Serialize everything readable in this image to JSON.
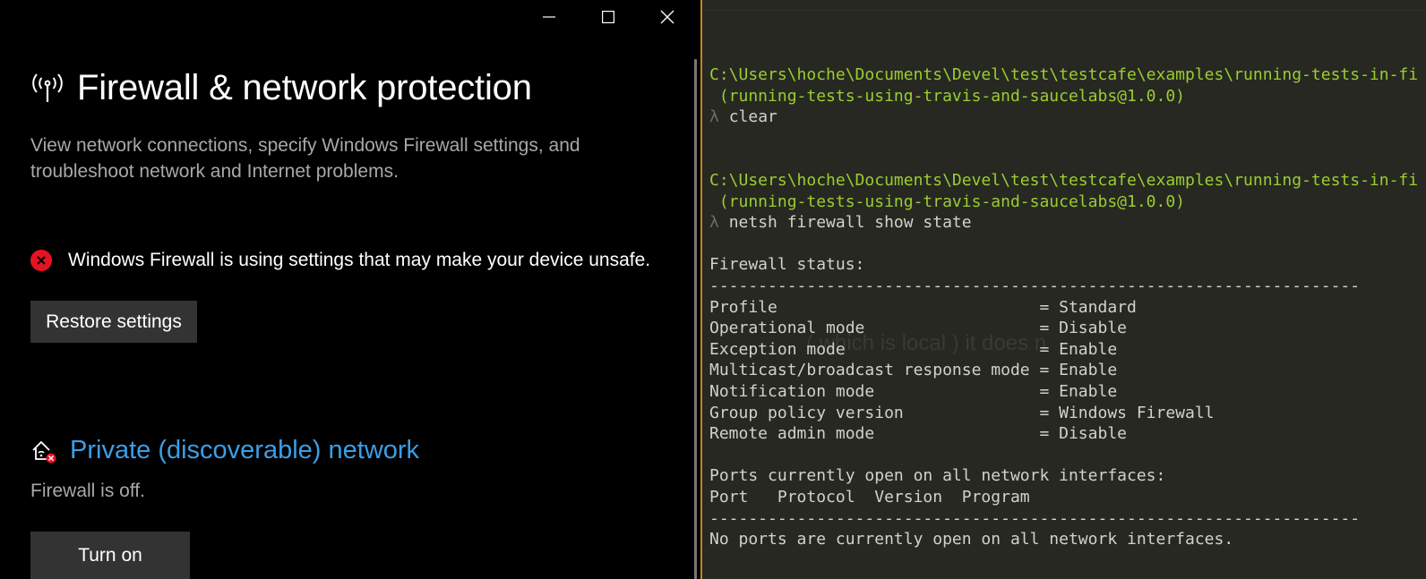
{
  "window": {
    "minimize_label": "Minimize",
    "maximize_label": "Maximize",
    "close_label": "Close"
  },
  "security": {
    "title": "Firewall & network protection",
    "title_icon": "wifi-broadcast-icon",
    "description": "View network connections, specify Windows Firewall settings, and troubleshoot network and Internet problems.",
    "warning_icon": "error-x-icon",
    "warning_text": "Windows Firewall is using settings that may make your device unsafe.",
    "restore_button": "Restore settings",
    "network": {
      "icon": "private-network-icon",
      "title": "Private (discoverable) network",
      "status": "Firewall is off.",
      "turn_on_button": "Turn on"
    },
    "colors": {
      "accent_link": "#3b9ee8",
      "error": "#e81123",
      "button_bg": "#333333"
    }
  },
  "terminal": {
    "ghost_text": "( which is local ) it does n",
    "lines": [
      {
        "text": "C:\\Users\\hoche\\Documents\\Devel\\test\\testcafe\\examples\\running-tests-in-fi",
        "style": "green"
      },
      {
        "text": " (running-tests-using-travis-and-saucelabs@1.0.0)",
        "style": "green"
      },
      {
        "prompt": "λ",
        "text": "clear"
      },
      {
        "text": ""
      },
      {
        "text": ""
      },
      {
        "text": "C:\\Users\\hoche\\Documents\\Devel\\test\\testcafe\\examples\\running-tests-in-fi",
        "style": "green"
      },
      {
        "text": " (running-tests-using-travis-and-saucelabs@1.0.0)",
        "style": "green"
      },
      {
        "prompt": "λ",
        "text": "netsh firewall show state"
      },
      {
        "text": ""
      },
      {
        "text": "Firewall status:"
      },
      {
        "text": "-------------------------------------------------------------------"
      },
      {
        "text": "Profile                           = Standard"
      },
      {
        "text": "Operational mode                  = Disable"
      },
      {
        "text": "Exception mode                    = Enable"
      },
      {
        "text": "Multicast/broadcast response mode = Enable"
      },
      {
        "text": "Notification mode                 = Enable"
      },
      {
        "text": "Group policy version              = Windows Firewall"
      },
      {
        "text": "Remote admin mode                 = Disable"
      },
      {
        "text": ""
      },
      {
        "text": "Ports currently open on all network interfaces:"
      },
      {
        "text": "Port   Protocol  Version  Program"
      },
      {
        "text": "-------------------------------------------------------------------"
      },
      {
        "text": "No ports are currently open on all network interfaces."
      }
    ],
    "colors": {
      "background": "#272822",
      "text": "#d2d2c8",
      "path": "#9acd32",
      "prompt": "#6d6d63"
    }
  }
}
